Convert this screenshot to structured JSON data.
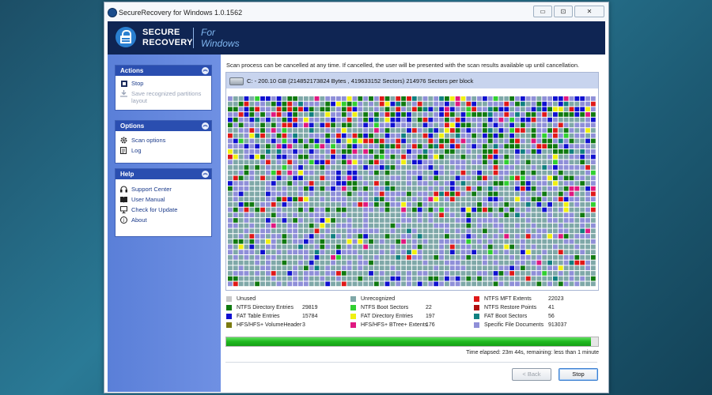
{
  "window": {
    "title": "SecureRecovery for Windows 1.0.1562",
    "controls": {
      "minimize": "▭",
      "maximize": "⊡",
      "close": "✕"
    }
  },
  "banner": {
    "logo_line1": "SECURE",
    "logo_line2": "RECOVERY",
    "tag_line1": "For",
    "tag_line2": "Windows"
  },
  "sidebar": {
    "actions": {
      "header": "Actions",
      "items": [
        {
          "label": "Stop",
          "icon": "stop-icon",
          "enabled": true
        },
        {
          "label": "Save recognized partitions layout",
          "icon": "download-icon",
          "enabled": false
        }
      ]
    },
    "options": {
      "header": "Options",
      "items": [
        {
          "label": "Scan options",
          "icon": "gear-icon"
        },
        {
          "label": "Log",
          "icon": "log-icon"
        }
      ]
    },
    "help": {
      "header": "Help",
      "items": [
        {
          "label": "Support Center",
          "icon": "headset-icon"
        },
        {
          "label": "User Manual",
          "icon": "book-icon"
        },
        {
          "label": "Check for Update",
          "icon": "monitor-icon"
        },
        {
          "label": "About",
          "icon": "info-icon"
        }
      ]
    }
  },
  "scan": {
    "message": "Scan process can be cancelled at any time. If cancelled, the user will be presented with the scan results available  up until cancellation.",
    "disk_info": "C: - 200.10 GB (214852173824 Bytes , 419633152 Sectors) 214976 Sectors per block",
    "elapsed": "Time elapsed: 23m 44s, remaining: less than 1 minute",
    "progress_percent": 98
  },
  "legend": [
    {
      "label": "Unused",
      "count": "",
      "color": "#c8c8c8"
    },
    {
      "label": "Unrecognized",
      "count": "",
      "color": "#7fa8a8"
    },
    {
      "label": "NTFS MFT Extents",
      "count": "22023",
      "color": "#e01818"
    },
    {
      "label": "NTFS Directory Entries",
      "count": "29819",
      "color": "#107a10"
    },
    {
      "label": "NTFS Boot Sectors",
      "count": "22",
      "color": "#30d030"
    },
    {
      "label": "NTFS Restore Points",
      "count": "41",
      "color": "#b01010"
    },
    {
      "label": "FAT Table Entries",
      "count": "15784",
      "color": "#1010d0"
    },
    {
      "label": "FAT Directory Entries",
      "count": "197",
      "color": "#f0f010"
    },
    {
      "label": "FAT Boot Sectors",
      "count": "56",
      "color": "#108080"
    },
    {
      "label": "HFS/HFS+ VolumeHeader",
      "count": "3",
      "color": "#7a7a10"
    },
    {
      "label": "HFS/HFS+ BTree+ Extents",
      "count": "176",
      "color": "#e01880"
    },
    {
      "label": "Specific File Documents",
      "count": "913037",
      "color": "#8f8fd8"
    }
  ],
  "buttons": {
    "back": "< Back",
    "stop": "Stop"
  }
}
